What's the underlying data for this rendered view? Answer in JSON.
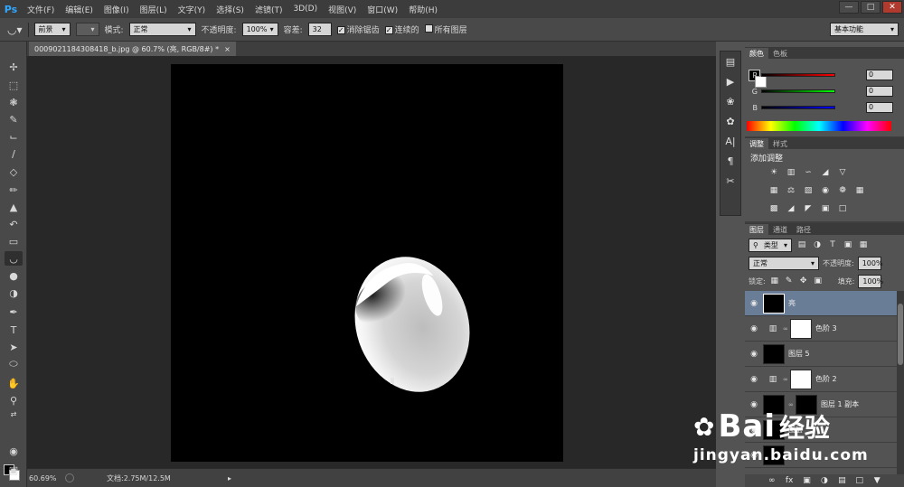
{
  "app": {
    "logo": "Ps"
  },
  "menu": [
    "文件(F)",
    "编辑(E)",
    "图像(I)",
    "图层(L)",
    "文字(Y)",
    "选择(S)",
    "滤镜(T)",
    "3D(D)",
    "视图(V)",
    "窗口(W)",
    "帮助(H)"
  ],
  "window_controls": {
    "minimize": "—",
    "restore": "□",
    "close": "✕"
  },
  "options": {
    "fill_source": "前景",
    "mode_label": "模式:",
    "mode_value": "正常",
    "opacity_label": "不透明度:",
    "opacity_value": "100%",
    "tolerance_label": "容差:",
    "tolerance_value": "32",
    "antialias_label": "消除锯齿",
    "contiguous_label": "连续的",
    "all_layers_label": "所有图层",
    "workspace": "基本功能"
  },
  "document": {
    "tab_title": "0009021184308418_b.jpg @ 60.7% (亮, RGB/8#) *",
    "tab_close": "×"
  },
  "status": {
    "zoom": "60.69%",
    "doc_info": "文档:2.75M/12.5M"
  },
  "color_panel": {
    "tabs": [
      "颜色",
      "色板"
    ],
    "channels": [
      {
        "label": "R",
        "value": "0",
        "color": "#ff0000"
      },
      {
        "label": "G",
        "value": "0",
        "color": "#00ff00"
      },
      {
        "label": "B",
        "value": "0",
        "color": "#0000ff"
      }
    ]
  },
  "adjust_panel": {
    "tabs": [
      "调整",
      "样式"
    ],
    "heading": "添加调整"
  },
  "layers_panel": {
    "tabs": [
      "图层",
      "通道",
      "路径"
    ],
    "filter_label": "类型",
    "blend_mode": "正常",
    "opacity_label": "不透明度:",
    "opacity_value": "100%",
    "lock_label": "锁定:",
    "fill_label": "填充:",
    "fill_value": "100%",
    "layers": [
      {
        "name": "亮",
        "selected": true
      },
      {
        "name": "色阶 3",
        "selected": false
      },
      {
        "name": "图层 5",
        "selected": false
      },
      {
        "name": "色阶 2",
        "selected": false
      },
      {
        "name": "图层 1 副本",
        "selected": false
      },
      {
        "name": "图层",
        "selected": false
      },
      {
        "name": "",
        "selected": false
      }
    ]
  },
  "watermark": {
    "brand": "Bai",
    "brand_cn": "经验",
    "url": "jingyan.baidu.com"
  },
  "colors": {
    "accent_blue": "#31a8ff",
    "selected_layer": "#6a7d97",
    "canvas": "#000000"
  }
}
